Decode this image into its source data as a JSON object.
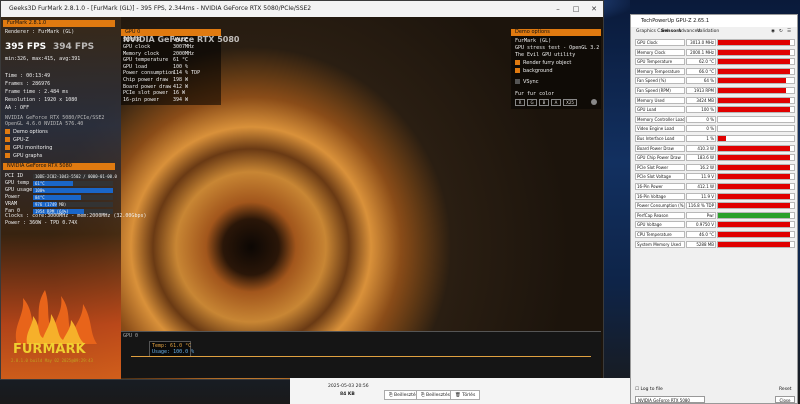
{
  "colors": {
    "accent": "#e07a10",
    "gz_bar": "#e00000",
    "gz_green": "#2aa02a",
    "fps_bar": "#1a66c8"
  },
  "furmark": {
    "title": "Geeks3D FurMark 2.8.1.0 - [FurMark (GL)] - 395 FPS, 2.344ms - NVIDIA GeForce RTX 5080/PCIe/SSE2",
    "overlay_header": "FurMark 2.8.1.0",
    "renderer_line": "Renderer : FurMark (GL)",
    "fps_main": "395 FPS",
    "fps_side": "394 FPS",
    "stats": [
      "min:326, max:415, avg:391",
      "Time          : 00:13:49",
      "Frames        : 286976",
      "Frame time    : 2.484 ms",
      "Resolution    : 1920 x 1080",
      "AA            : OFF"
    ],
    "gpu_lines": [
      "NVIDIA GeForce RTX 5080/PCIe/SSE2",
      "OpenGL 4.6.0 NVIDIA 576.40"
    ],
    "demo_toggles": [
      {
        "label": "Demo options"
      },
      {
        "label": "GPU-Z"
      },
      {
        "label": "GPU monitoring"
      },
      {
        "label": "GPU graphs"
      }
    ],
    "gpu_section_title": "NVIDIA GeForce RTX 5080",
    "bar_rows": [
      {
        "label": "PCI ID",
        "value": "10DE-2C02-1043-5502 / 0000-01-00.0",
        "fill": 0
      },
      {
        "label": "GPU temp",
        "value": "61°C",
        "fill": 0.5
      },
      {
        "label": "GPU usage",
        "value": "100%",
        "fill": 1
      },
      {
        "label": "Power",
        "value": "84°C",
        "fill": 0.6
      },
      {
        "label": "VRAM",
        "value": "976 (1749 MB)",
        "fill": 0.3
      },
      {
        "label": "Fan 0",
        "value": "1954 RPM (64%)",
        "fill": 0.64
      }
    ],
    "clocks_line": "Clocks  : core:3000MHz - mem:2000MHz (32.00Gbps)",
    "power_line": "Power   : 360W - TPD 0.74X",
    "sensor_panel": {
      "header": "GPU 0",
      "title_a": "NVIDIA GeForce RTX 5080",
      "col1": "SENSOR",
      "col2": "VALUE",
      "rows": [
        {
          "k": "GPU clock",
          "v": "3007MHz"
        },
        {
          "k": "Memory clock",
          "v": "2000MHz"
        },
        {
          "k": "GPU temperature",
          "v": "61 °C"
        },
        {
          "k": "GPU load",
          "v": "100 %"
        },
        {
          "k": "Power consumption",
          "v": "114 % TDP"
        },
        {
          "k": "Chip power draw",
          "v": "198 W"
        },
        {
          "k": "Board power draw",
          "v": "412 W"
        },
        {
          "k": "PCIe slot power",
          "v": "16 W"
        },
        {
          "k": "16-pin power",
          "v": "394 W"
        }
      ]
    },
    "demo_panel": {
      "header": "Demo options",
      "line1": "FurMark (GL)",
      "line2": "GPU stress test - OpenGL 3.2",
      "line3": "The Evil GPU utility",
      "options": [
        "Render furry object",
        "background"
      ],
      "vsync": "VSync",
      "fur_label": "Fur fur color",
      "fur_buttons": [
        "R",
        "G",
        "B",
        "A",
        "X25"
      ]
    },
    "graph_header": "GPU 0",
    "graph_legend": [
      "Temp: 61.0 °C",
      "Usage: 100.0 %"
    ],
    "logo_text": "FURMARK",
    "logo_sub": "2.8.1.0 build May 02 2025@09:29:43"
  },
  "gpuz": {
    "title": "TechPowerUp GPU-Z 2.65.1",
    "tabs": [
      "Graphics Card",
      "Sensors",
      "Advanced",
      "Validation"
    ],
    "rows": [
      {
        "label": "GPU Clock",
        "value": "3013.0 MHz",
        "fill": 0.95
      },
      {
        "label": "Memory Clock",
        "value": "2000.1 MHz",
        "fill": 0.95
      },
      {
        "label": "GPU Temperature",
        "value": "62.0 °C",
        "fill": 0.95
      },
      {
        "label": "Memory Temperature",
        "value": "66.0 °C",
        "fill": 0.95
      },
      {
        "label": "Fan Speed (%)",
        "value": "64 %",
        "fill": 0.9
      },
      {
        "label": "Fan Speed (RPM)",
        "value": "1913 RPM",
        "fill": 0.9
      },
      {
        "label": "Memory Used",
        "value": "3424 MB",
        "fill": 0.95
      },
      {
        "label": "GPU Load",
        "value": "100 %",
        "fill": 0.95
      },
      {
        "label": "Memory Controller Load",
        "value": "0 %",
        "fill": 0.0
      },
      {
        "label": "Video Engine Load",
        "value": "0 %",
        "fill": 0.0
      },
      {
        "label": "Bus Interface Load",
        "value": "1 %",
        "fill": 0.1
      },
      {
        "label": "Board Power Draw",
        "value": "410.3 W",
        "fill": 0.95
      },
      {
        "label": "GPU Chip Power Draw",
        "value": "183.6 W",
        "fill": 0.95
      },
      {
        "label": "PCIe Slot Power",
        "value": "16.2 W",
        "fill": 0.95
      },
      {
        "label": "PCIe Slot Voltage",
        "value": "11.9 V",
        "fill": 0.95
      },
      {
        "label": "16-Pin Power",
        "value": "412.1 W",
        "fill": 0.95
      },
      {
        "label": "16-Pin Voltage",
        "value": "11.9 V",
        "fill": 0.95
      },
      {
        "label": "Power Consumption (%)",
        "value": "116.8 % TDP",
        "fill": 0.95
      },
      {
        "label": "PerfCap Reason",
        "value": "Pwr",
        "fill": 0.95,
        "green": true
      },
      {
        "label": "GPU Voltage",
        "value": "0.9750 V",
        "fill": 0.95
      },
      {
        "label": "CPU Temperature",
        "value": "46.0 °C",
        "fill": 0.95
      },
      {
        "label": "System Memory Used",
        "value": "5288 MB",
        "fill": 0.95
      }
    ],
    "log_label": "Log to file",
    "reset_label": "Reset",
    "gpu_select": "NVIDIA GeForce RTX 5080",
    "close_label": "Close"
  },
  "taskbar": {
    "timestamp": "2025-05-03 20:56",
    "size": "84 KB",
    "buttons": [
      "Beillesztés",
      "Beillesztés",
      "Törlés"
    ]
  }
}
